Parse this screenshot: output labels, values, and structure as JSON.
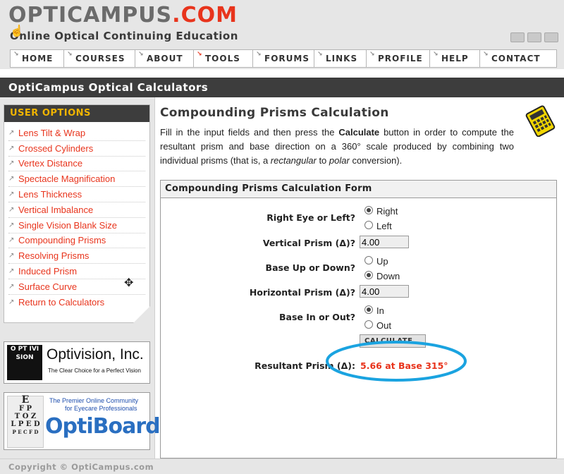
{
  "site": {
    "logo_main": "OPTICAMPUS",
    "logo_dot": ".COM",
    "tagline": "Online Optical Continuing Education",
    "accent_color": "#e8341c"
  },
  "nav": {
    "items": [
      {
        "label": "HOME",
        "active": false
      },
      {
        "label": "COURSES",
        "active": false
      },
      {
        "label": "ABOUT",
        "active": false
      },
      {
        "label": "TOOLS",
        "active": true
      },
      {
        "label": "FORUMS",
        "active": false
      },
      {
        "label": "LINKS",
        "active": false
      },
      {
        "label": "PROFILE",
        "active": false
      },
      {
        "label": "HELP",
        "active": false
      },
      {
        "label": "CONTACT",
        "active": false
      }
    ]
  },
  "page_title": "OptiCampus Optical Calculators",
  "user_options": {
    "heading": "USER OPTIONS",
    "items": [
      "Lens Tilt & Wrap",
      "Crossed Cylinders",
      "Vertex Distance",
      "Spectacle Magnification",
      "Lens Thickness",
      "Vertical Imbalance",
      "Single Vision Blank Size",
      "Compounding Prisms",
      "Resolving Prisms",
      "Induced Prism",
      "Surface Curve",
      "Return to Calculators"
    ]
  },
  "ads": {
    "optivision": {
      "logo_text": "O PT IVI SION",
      "name": "Optivision, Inc.",
      "slogan": "The Clear Choice for a Perfect Vision"
    },
    "optiboard": {
      "tag_line1": "The Premier Online Community",
      "tag_line2": "for Eyecare Professionals",
      "name": "OptiBoard"
    }
  },
  "main": {
    "heading": "Compounding Prisms Calculation",
    "intro_part1": "Fill in the input fields and then press the ",
    "intro_bold": "Calculate",
    "intro_part2": " button in order to compute the resultant prism and base direction on a 360° scale produced by combining two individual prisms (that is, a ",
    "intro_italic": "rectangular",
    "intro_part3": " to ",
    "intro_italic2": "polar",
    "intro_part4": " conversion)."
  },
  "form": {
    "heading": "Compounding Prisms Calculation Form",
    "eye_label": "Right Eye or Left?",
    "eye_options": [
      "Right",
      "Left"
    ],
    "eye_selected": "Right",
    "vertical_label": "Vertical Prism (Δ)?",
    "vertical_value": "4.00",
    "base_ud_label": "Base Up or Down?",
    "base_ud_options": [
      "Up",
      "Down"
    ],
    "base_ud_selected": "Down",
    "horizontal_label": "Horizontal Prism (Δ)?",
    "horizontal_value": "4.00",
    "base_io_label": "Base In or Out?",
    "base_io_options": [
      "In",
      "Out"
    ],
    "base_io_selected": "In",
    "calculate_label": "CALCULATE",
    "result_label": "Resultant Prism (Δ):",
    "result_value": "5.66 at Base 315°"
  },
  "footer": {
    "copyright": "Copyright © OptiCampus.com"
  },
  "icons": {
    "calculator": "calculator-icon",
    "nav_arrow": "arrow-icon",
    "move_cursor": "move-cursor-icon",
    "hand_cursor": "hand-cursor-icon"
  }
}
